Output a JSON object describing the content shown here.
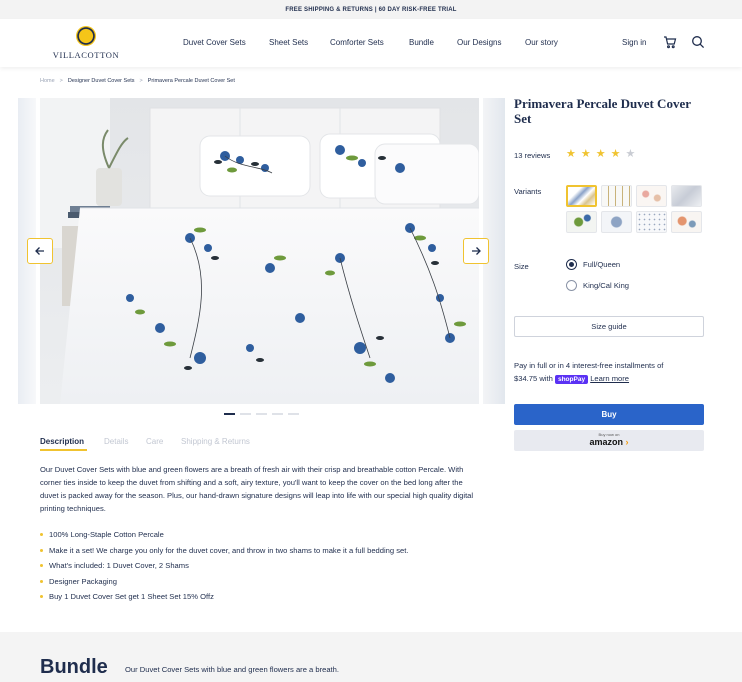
{
  "promo": {
    "text": "FREE SHIPPING & RETURNS | 60 DAY RISK-FREE TRIAL"
  },
  "brand": {
    "name": "VILLACOTTON"
  },
  "nav": {
    "items": [
      {
        "label": "Duvet Cover Sets"
      },
      {
        "label": "Sheet Sets"
      },
      {
        "label": "Comforter Sets"
      },
      {
        "label": "Bundle"
      },
      {
        "label": "Our Designs"
      },
      {
        "label": "Our story"
      }
    ],
    "signin": "Sign in"
  },
  "icons": {
    "cart": "cart-icon",
    "search": "search-icon",
    "prev": "arrow-left-icon",
    "next": "arrow-right-icon"
  },
  "breadcrumb": {
    "home": "Home",
    "category": "Designer Duvet Cover Sets",
    "current": "Primavera Percale Duvet Cover Set",
    "separator": ">"
  },
  "gallery": {
    "total_images": 5,
    "active_index": 0
  },
  "tabs": [
    {
      "label": "Description",
      "active": true
    },
    {
      "label": "Details",
      "active": false
    },
    {
      "label": "Care",
      "active": false
    },
    {
      "label": "Shipping & Returns",
      "active": false
    }
  ],
  "description": {
    "text": "Our Duvet Cover Sets with blue and green flowers are a breath of fresh air with their crisp and breathable cotton Percale. With corner ties inside to keep the duvet from shifting and a soft, airy texture, you'll want to keep the cover on the bed long after the duvet is packed away for the season. Plus, our hand-drawn signature designs will leap into life with our special high quality digital printing techniques.",
    "bullets": [
      "100% Long-Staple Cotton Percale",
      "Make it a set! We charge you only for the duvet cover, and throw in two shams to make it a full bedding set.",
      "What's included: 1 Duvet Cover, 2 Shams",
      "Designer Packaging",
      "Buy 1 Duvet Cover Set get 1 Sheet Set 15% Offz"
    ]
  },
  "product": {
    "title": "Primavera Percale Duvet Cover Set",
    "reviews": "13 reviews",
    "rating": 4,
    "rating_max": 5,
    "variants_label": "Variants",
    "variant_count": 8,
    "selected_variant": 0,
    "size_label": "Size",
    "sizes": [
      {
        "label": "Full/Queen",
        "selected": true
      },
      {
        "label": "King/Cal King",
        "selected": false
      }
    ],
    "size_guide": "Size guide",
    "installments_text": "Pay in full or in 4 interest-free installments of",
    "installment_amount": "$34.75 with",
    "shop_pay": "shopPay",
    "learn_more": "Learn more",
    "buy": "Buy",
    "amazon_small": "Buy now on",
    "amazon_word": "amazon"
  },
  "bundle": {
    "title": "Bundle",
    "text": "Our Duvet Cover Sets with blue and green flowers are a breath."
  },
  "colors": {
    "navy": "#1f2d4d",
    "gold": "#f0c330",
    "buy_blue": "#2a64c9",
    "star_on": "#f0c330",
    "star_off": "#c9ccd3"
  }
}
